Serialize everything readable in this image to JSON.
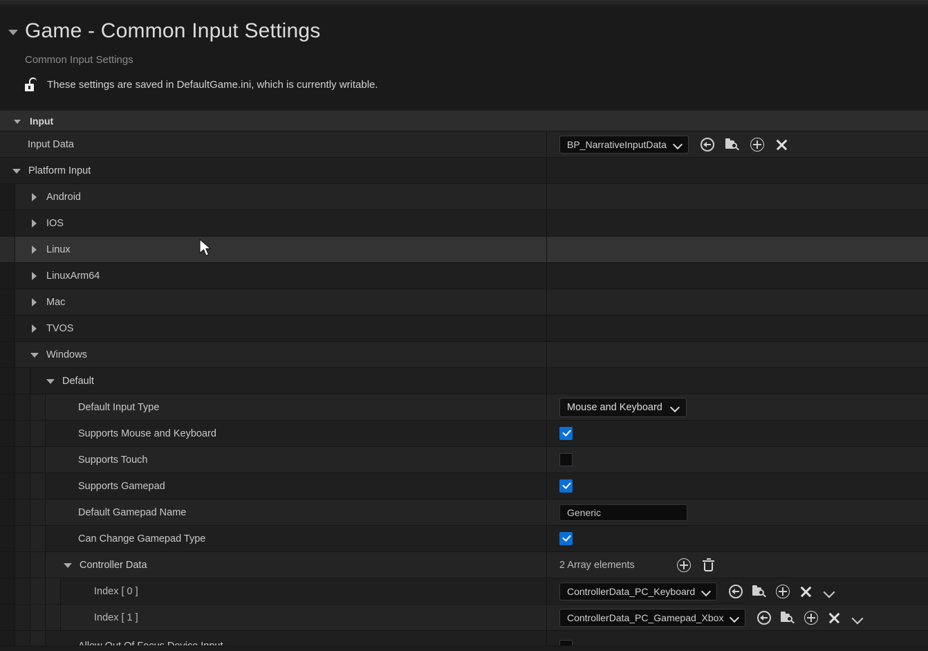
{
  "header": {
    "title": "Game - Common Input Settings",
    "subtitle": "Common Input Settings",
    "saved_note": "These settings are saved in DefaultGame.ini, which is currently writable.",
    "lock_icon": "unlocked-padlock-icon",
    "collapse_icon": "triangle-down-icon"
  },
  "accent_colors": {
    "checkbox_on": "#0b6fd8",
    "panel_bg": "#1d1d1d",
    "category_header_bg": "#2d2d2d",
    "row_hover_bg": "#333333",
    "text_primary": "#c9c9c9",
    "text_dim": "#8b8b8b"
  },
  "icons": {
    "browse": "browse-to-asset-icon",
    "folder_search": "folder-search-icon",
    "use_selected": "use-selected-asset-icon",
    "clear": "clear-asset-icon",
    "add_element": "add-array-element-icon",
    "delete_all": "delete-array-icon",
    "element_options": "array-element-options-chevron-icon"
  },
  "tree": {
    "category": {
      "label": "Input",
      "expanded": true
    },
    "input_data": {
      "label": "Input Data",
      "value": "BP_NarrativeInputData"
    },
    "platform_input": {
      "label": "Platform Input",
      "expanded": true
    },
    "platforms": [
      {
        "label": "Android",
        "expanded": false,
        "hovered": false
      },
      {
        "label": "IOS",
        "expanded": false,
        "hovered": false
      },
      {
        "label": "Linux",
        "expanded": false,
        "hovered": true
      },
      {
        "label": "LinuxArm64",
        "expanded": false,
        "hovered": false
      },
      {
        "label": "Mac",
        "expanded": false,
        "hovered": false
      },
      {
        "label": "TVOS",
        "expanded": false,
        "hovered": false
      },
      {
        "label": "Windows",
        "expanded": true,
        "hovered": false
      }
    ],
    "default_group": {
      "label": "Default",
      "expanded": true
    },
    "properties": {
      "default_input_type": {
        "label": "Default Input Type",
        "value": "Mouse and Keyboard"
      },
      "supports_mouse_keyboard": {
        "label": "Supports Mouse and Keyboard",
        "checked": true
      },
      "supports_touch": {
        "label": "Supports Touch",
        "checked": false
      },
      "supports_gamepad": {
        "label": "Supports Gamepad",
        "checked": true
      },
      "default_gamepad_name": {
        "label": "Default Gamepad Name",
        "value": "Generic"
      },
      "can_change_gamepad_type": {
        "label": "Can Change Gamepad Type",
        "checked": true
      }
    },
    "controller_data": {
      "label": "Controller Data",
      "expanded": true,
      "count_text": "2 Array elements",
      "elements": [
        {
          "label": "Index [ 0 ]",
          "value": "ControllerData_PC_Keyboard"
        },
        {
          "label": "Index [ 1 ]",
          "value": "ControllerData_PC_Gamepad_Xbox"
        }
      ]
    },
    "partial_row": {
      "label": "Allow Out Of Focus Device Input"
    }
  }
}
